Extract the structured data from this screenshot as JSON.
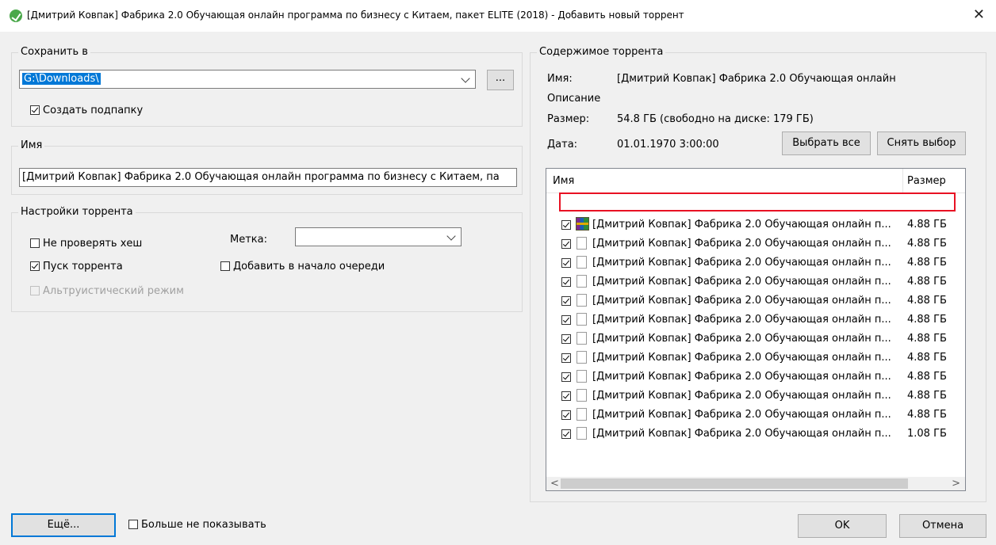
{
  "window": {
    "title": "[Дмитрий Ковпак] Фабрика 2.0 Обучающая онлайн программа по бизнесу с Китаем, пакет ELITE (2018) - Добавить новый торрент",
    "close": "✕"
  },
  "save": {
    "legend": "Сохранить в",
    "path": "G:\\Downloads\\",
    "browse_label": "...",
    "subfolder_label": "Создать подпапку",
    "subfolder_checked": true
  },
  "name": {
    "legend": "Имя",
    "value": "[Дмитрий Ковпак] Фабрика 2.0 Обучающая онлайн программа по бизнесу с Китаем, па"
  },
  "settings": {
    "legend": "Настройки торрента",
    "skip_hash_label": "Не проверять хеш",
    "skip_hash_checked": false,
    "start_label": "Пуск торрента",
    "start_checked": true,
    "altruistic_label": "Альтруистический режим",
    "label_caption": "Метка:",
    "label_value": "",
    "queue_top_label": "Добавить в начало очереди",
    "queue_top_checked": false
  },
  "content": {
    "legend": "Содержимое торрента",
    "name_label": "Имя:",
    "name_value": "[Дмитрий Ковпак] Фабрика 2.0 Обучающая онлайн",
    "desc_label": "Описание",
    "size_label": "Размер:",
    "size_value": "54.8 ГБ (свободно на диске: 179 ГБ)",
    "date_label": "Дата:",
    "date_value": "01.01.1970 3:00:00",
    "select_all": "Выбрать все",
    "deselect": "Снять выбор",
    "col_name": "Имя",
    "col_size": "Размер",
    "files": [
      {
        "name": "[Дмитрий Ковпак] Фабрика 2.0 Обучающая онлайн п...",
        "size": "4.88 ГБ",
        "icon": "rar-archive-icon"
      },
      {
        "name": "[Дмитрий Ковпак] Фабрика 2.0 Обучающая онлайн п...",
        "size": "4.88 ГБ",
        "icon": "file-icon"
      },
      {
        "name": "[Дмитрий Ковпак] Фабрика 2.0 Обучающая онлайн п...",
        "size": "4.88 ГБ",
        "icon": "file-icon"
      },
      {
        "name": "[Дмитрий Ковпак] Фабрика 2.0 Обучающая онлайн п...",
        "size": "4.88 ГБ",
        "icon": "file-icon"
      },
      {
        "name": "[Дмитрий Ковпак] Фабрика 2.0 Обучающая онлайн п...",
        "size": "4.88 ГБ",
        "icon": "file-icon"
      },
      {
        "name": "[Дмитрий Ковпак] Фабрика 2.0 Обучающая онлайн п...",
        "size": "4.88 ГБ",
        "icon": "file-icon"
      },
      {
        "name": "[Дмитрий Ковпак] Фабрика 2.0 Обучающая онлайн п...",
        "size": "4.88 ГБ",
        "icon": "file-icon"
      },
      {
        "name": "[Дмитрий Ковпак] Фабрика 2.0 Обучающая онлайн п...",
        "size": "4.88 ГБ",
        "icon": "file-icon"
      },
      {
        "name": "[Дмитрий Ковпак] Фабрика 2.0 Обучающая онлайн п...",
        "size": "4.88 ГБ",
        "icon": "file-icon"
      },
      {
        "name": "[Дмитрий Ковпак] Фабрика 2.0 Обучающая онлайн п...",
        "size": "4.88 ГБ",
        "icon": "file-icon"
      },
      {
        "name": "[Дмитрий Ковпак] Фабрика 2.0 Обучающая онлайн п...",
        "size": "4.88 ГБ",
        "icon": "file-icon"
      },
      {
        "name": "[Дмитрий Ковпак] Фабрика 2.0 Обучающая онлайн п...",
        "size": "1.08 ГБ",
        "icon": "file-icon"
      }
    ]
  },
  "footer": {
    "more": "Ещё...",
    "dont_show": "Больше не показывать",
    "ok": "OK",
    "cancel": "Отмена"
  },
  "colors": {
    "accent": "#0078d7",
    "highlight_border": "#e81123"
  }
}
